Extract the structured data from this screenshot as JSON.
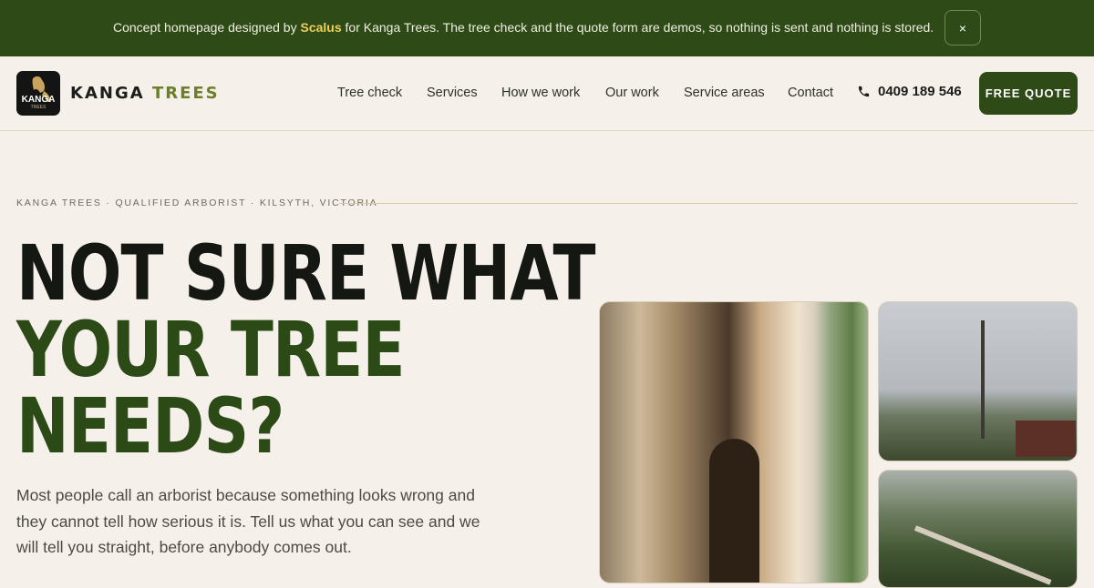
{
  "banner": {
    "prefix": "Concept homepage designed by",
    "brand": "Scalus",
    "suffix": "for Kanga Trees. The tree check and the quote form are demos, so nothing is sent and nothing is stored.",
    "close_label": "×"
  },
  "nav": {
    "logo_word": "KANGA",
    "logo_sub": "TREES",
    "brand_first": "KANGA",
    "brand_second": "TREES",
    "links": [
      "Tree check",
      "Services",
      "How we work",
      "Our work",
      "Service areas",
      "Contact"
    ],
    "phone": "0409 189 546",
    "cta": "FREE QUOTE"
  },
  "hero": {
    "eyebrow": "KANGA TREES · QUALIFIED ARBORIST · KILSYTH, VICTORIA",
    "headline": [
      "NOT SURE WHAT",
      "YOUR TREE",
      "NEEDS?"
    ],
    "intro": "Most people call an arborist because something looks wrong and they cannot tell how serious it is. Tell us what you can see and we will tell you straight, before anybody comes out."
  },
  "colors": {
    "accent": "#2e4a17",
    "highlight": "#f0cf5a",
    "background": "#f5f0ea"
  },
  "icons": {
    "phone": "phone-icon",
    "close": "close-icon"
  }
}
